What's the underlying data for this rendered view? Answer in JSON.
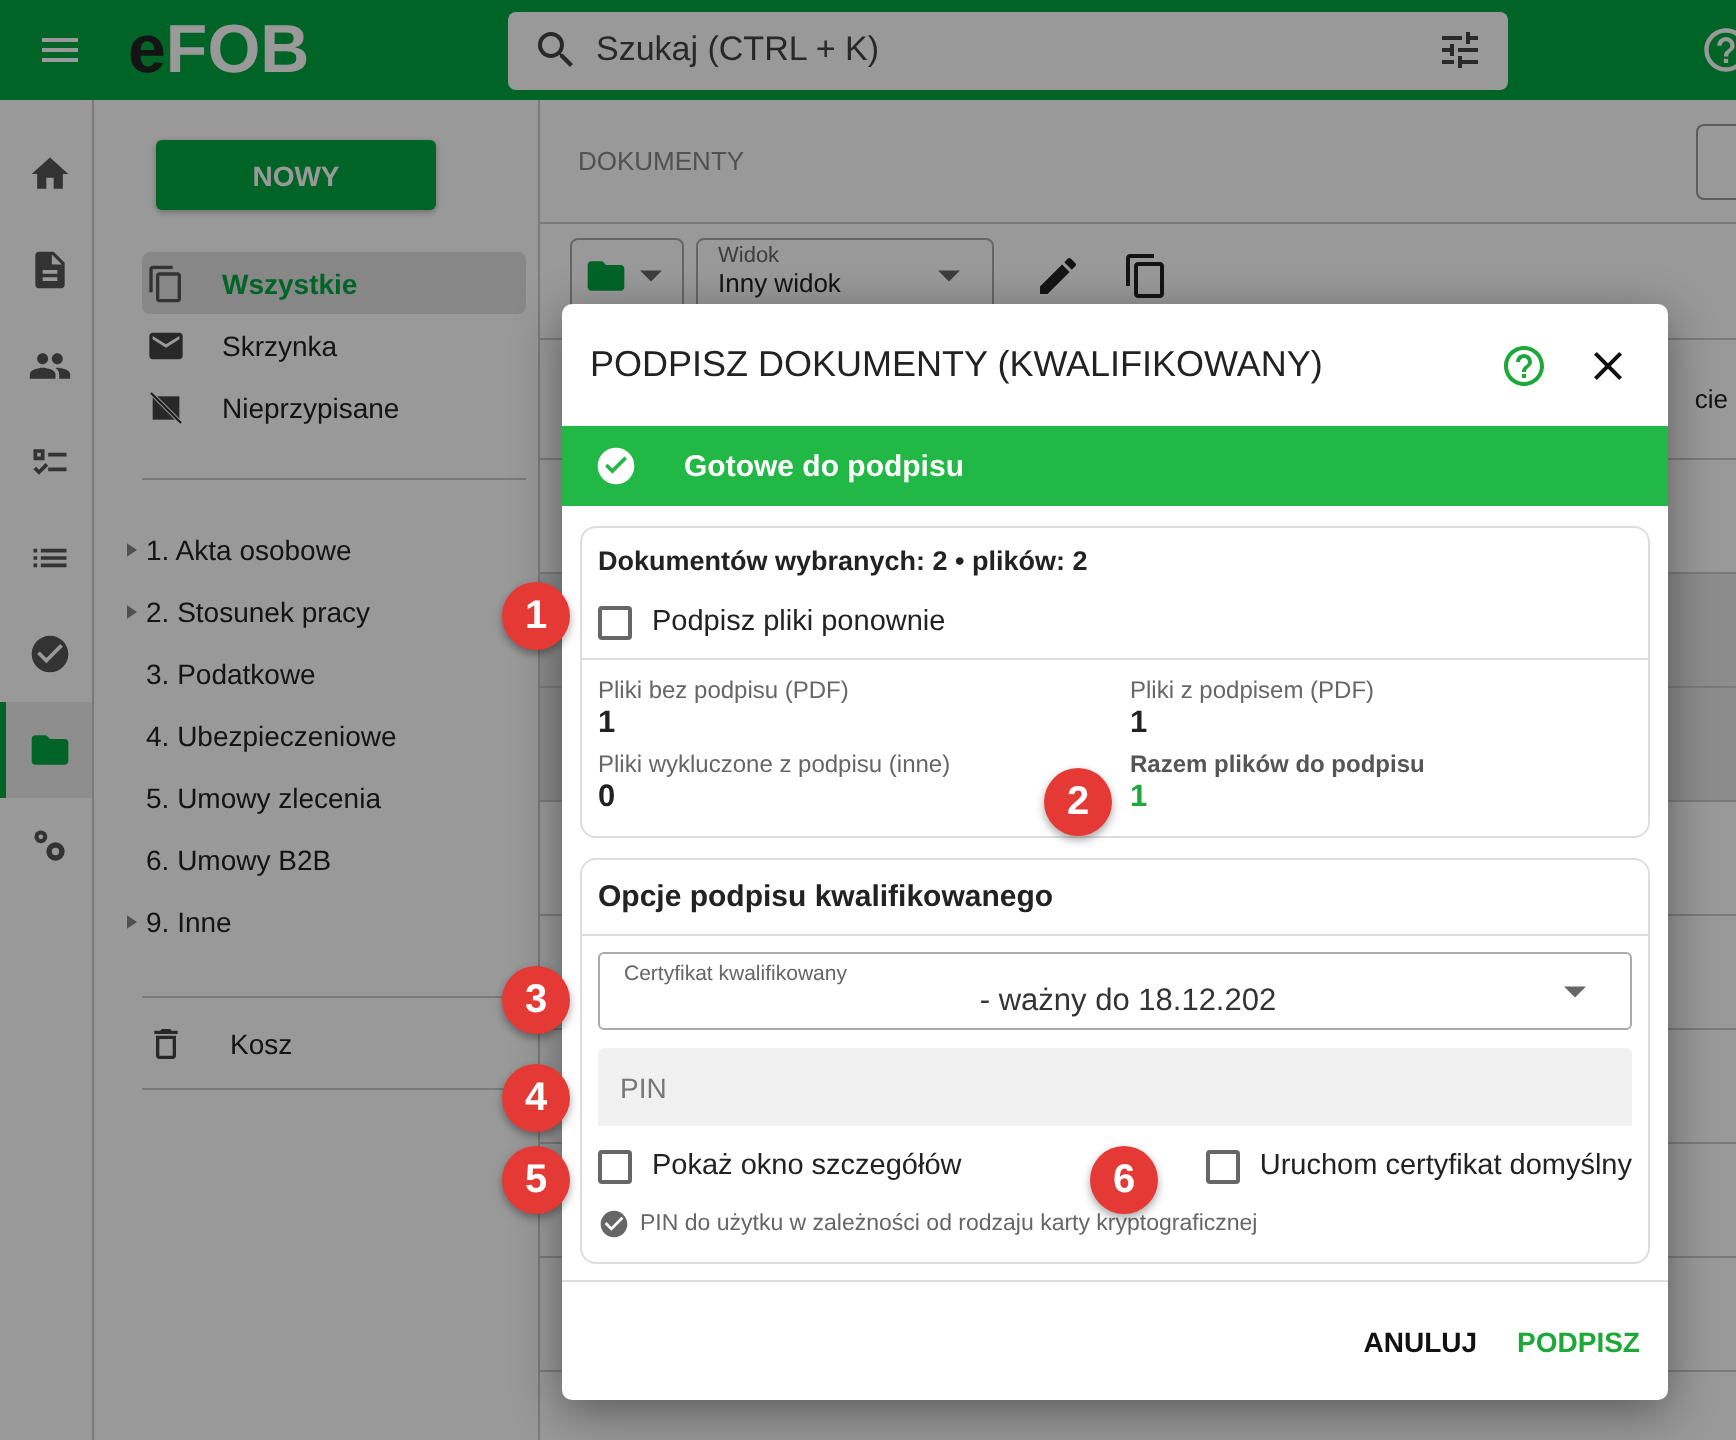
{
  "app_bar": {
    "logo": "eFOB",
    "search": {
      "placeholder": "Szukaj (CTRL + K)"
    }
  },
  "rail": [
    {
      "kind": "home",
      "selected": false
    },
    {
      "kind": "document",
      "selected": false
    },
    {
      "kind": "people",
      "selected": false
    },
    {
      "kind": "checklist",
      "selected": false
    },
    {
      "kind": "list",
      "selected": false
    },
    {
      "kind": "done",
      "selected": false
    },
    {
      "kind": "folder",
      "selected": true
    },
    {
      "kind": "settings",
      "selected": false
    }
  ],
  "sidebar": {
    "new_button": "NOWY",
    "nav": [
      {
        "label": "Wszystkie",
        "kind": "copy",
        "selected": true
      },
      {
        "label": "Skrzynka",
        "kind": "mail",
        "selected": false
      },
      {
        "label": "Nieprzypisane",
        "kind": "unassigned",
        "selected": false
      }
    ],
    "tree": [
      {
        "label": "1. Akta osobowe",
        "expandable": true
      },
      {
        "label": "2. Stosunek pracy",
        "expandable": true
      },
      {
        "label": "3. Podatkowe",
        "expandable": false
      },
      {
        "label": "4. Ubezpieczeniowe",
        "expandable": false
      },
      {
        "label": "5. Umowy zlecenia",
        "expandable": false
      },
      {
        "label": "6. Umowy B2B",
        "expandable": false
      },
      {
        "label": "9. Inne",
        "expandable": true
      }
    ],
    "trash": "Kosz"
  },
  "main": {
    "breadcrumb": "DOKUMENTY",
    "view_select": {
      "label": "Widok",
      "value": "Inny widok"
    },
    "column_fragment": "cie",
    "rows": [
      {
        "selected": false
      },
      {
        "selected": true
      },
      {
        "selected": true
      },
      {
        "selected": false
      },
      {
        "selected": false
      },
      {
        "selected": false
      },
      {
        "selected": false
      },
      {
        "selected": false
      }
    ]
  },
  "dialog": {
    "title": "PODPISZ DOKUMENTY (KWALIFIKOWANY)",
    "banner": "Gotowe do podpisu",
    "summary": "Dokumentów wybranych: 2 • plików: 2",
    "resign": {
      "label": "Podpisz pliki ponownie",
      "checked": false
    },
    "stats": [
      {
        "label": "Pliki bez podpisu (PDF)",
        "value": "1",
        "kind": "normal"
      },
      {
        "label": "Pliki z podpisem (PDF)",
        "value": "1",
        "kind": "normal"
      },
      {
        "label": "Pliki wykluczone z podpisu (inne)",
        "value": "0",
        "kind": "normal"
      },
      {
        "label": "Razem plików do podpisu",
        "value": "1",
        "kind": "total"
      }
    ],
    "options_title": "Opcje podpisu kwalifikowanego",
    "certificate": {
      "label": "Certyfikat kwalifikowany",
      "value": "- ważny do 18.12.202"
    },
    "pin": {
      "placeholder": "PIN"
    },
    "options": [
      {
        "label": "Pokaż okno szczegółów",
        "checked": false
      },
      {
        "label": "Uruchom certyfikat domyślny",
        "checked": false
      }
    ],
    "hint": "PIN do użytku w zależności od rodzaju karty kryptograficznej",
    "buttons": [
      {
        "label": "ANULUJ",
        "kind": "secondary"
      },
      {
        "label": "PODPISZ",
        "kind": "primary"
      }
    ]
  },
  "markers": [
    {
      "number": "1"
    },
    {
      "number": "2"
    },
    {
      "number": "3"
    },
    {
      "number": "4"
    },
    {
      "number": "5"
    },
    {
      "number": "6"
    }
  ]
}
